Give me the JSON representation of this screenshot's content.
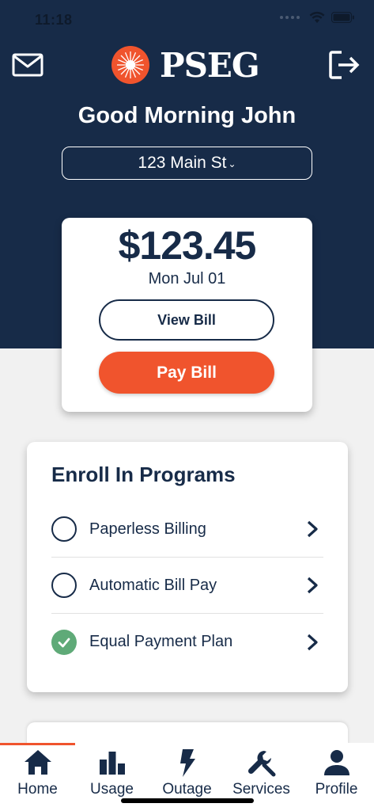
{
  "status_bar": {
    "time": "11:18"
  },
  "header": {
    "logo_text": "PSEG",
    "greeting": "Good Morning John",
    "address": "123 Main St",
    "address_chevron": "⌄"
  },
  "bill": {
    "amount": "$123.45",
    "due_date": "Mon Jul 01",
    "view_label": "View Bill",
    "pay_label": "Pay Bill"
  },
  "programs": {
    "title": "Enroll In Programs",
    "items": [
      {
        "label": "Paperless Billing",
        "enrolled": false
      },
      {
        "label": "Automatic Bill Pay",
        "enrolled": false
      },
      {
        "label": "Equal Payment Plan",
        "enrolled": true
      }
    ]
  },
  "tabs": [
    {
      "label": "Home",
      "icon": "home-icon",
      "active": true
    },
    {
      "label": "Usage",
      "icon": "bar-chart-icon",
      "active": false
    },
    {
      "label": "Outage",
      "icon": "lightning-icon",
      "active": false
    },
    {
      "label": "Services",
      "icon": "wrench-icon",
      "active": false
    },
    {
      "label": "Profile",
      "icon": "person-icon",
      "active": false
    }
  ],
  "colors": {
    "navy": "#172b48",
    "accent": "#f0542d",
    "success": "#5faa78",
    "background": "#f1f1f1"
  }
}
